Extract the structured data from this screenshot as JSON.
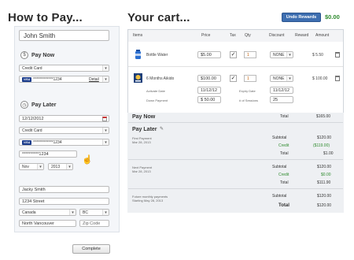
{
  "headings": {
    "how_to_pay": "How to Pay...",
    "your_cart": "Your cart..."
  },
  "undo_rewards": {
    "label": "Undo Rewards",
    "amount": "$0.00"
  },
  "payer": {
    "name": "John Smith"
  },
  "pay_now": {
    "label": "Pay Now",
    "method": "Credit Card",
    "card": "*************1234",
    "detail_link": "Detail"
  },
  "pay_later": {
    "label": "Pay Later",
    "date": "12/12/2012",
    "method": "Credit Card",
    "card": "*************1234",
    "card2": "**********1234",
    "month": "Nov",
    "year": "2013"
  },
  "billing": {
    "name": "Jacky Smith",
    "address": "1234 Street",
    "country": "Canada",
    "province": "BC",
    "city": "North Vancouver",
    "zip_placeholder": "Zip Code"
  },
  "complete_button": "Complete",
  "cart": {
    "headers": {
      "items": "Items",
      "price": "Price",
      "tax": "Tax",
      "qty": "Qty",
      "discount": "Discount",
      "reward": "Reward",
      "amount": "Amount"
    },
    "rows": [
      {
        "name": "Bottle Water",
        "price": "$5.00",
        "tax": "✓",
        "qty": "1",
        "discount": "NONE",
        "amount": "$ 5.50"
      },
      {
        "name": "6 Months Aikido",
        "price": "$100.00",
        "tax": "✓",
        "qty": "1",
        "discount": "NONE",
        "amount": "$ 100.00",
        "activate_label": "Activate Date",
        "activate_value": "11/12/12",
        "down_label": "Down Payment",
        "down_value": "$ 50.00",
        "expiry_label": "Expiry Date",
        "expiry_value": "11/12/12",
        "sessions_label": "# of Sessions",
        "sessions_value": "25"
      }
    ]
  },
  "summary": {
    "pay_now_label": "Pay Now",
    "pay_now_total_label": "Total",
    "pay_now_total": "$165.00",
    "pay_later_label": "Pay Later",
    "first_payment_label": "First Payment",
    "first_payment_date": "Mar 28, 2013",
    "subtotal_label": "Subtotal",
    "credit_label": "Credit",
    "total_label": "Total",
    "first": {
      "subtotal": "$120.00",
      "credit": "($119.00)",
      "total": "$1.00"
    },
    "next_payment_label": "Next Payment",
    "next_payment_date": "Mar 28, 2013",
    "next": {
      "subtotal": "$120.00",
      "credit": "$0.00",
      "total": "$111.90"
    },
    "future_label": "Future monthly payments",
    "future_date": "Starting May 28, 2013",
    "future": {
      "subtotal": "$120.00",
      "total": "$120.00"
    }
  },
  "colors": {
    "accent": "#3d6eb0",
    "green": "#2d8a2d",
    "orange": "#c25a00"
  }
}
